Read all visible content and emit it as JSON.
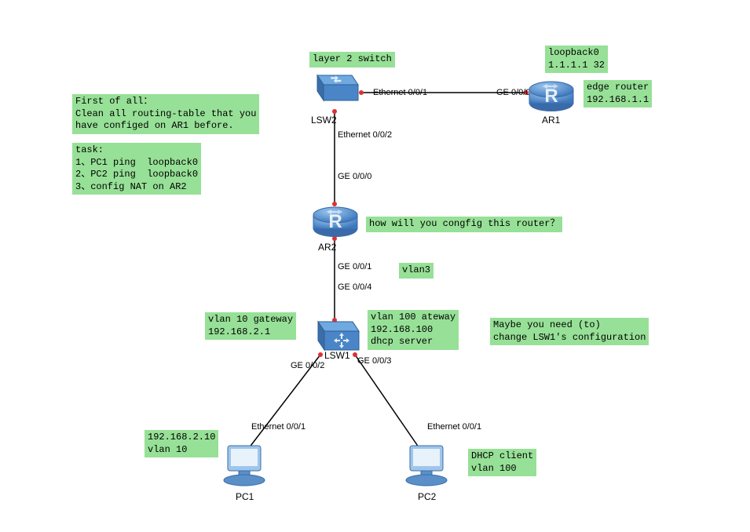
{
  "notes": {
    "layer2switch": "layer 2 switch",
    "loopback": "loopback0\n1.1.1.1 32",
    "edgeRouter": "edge router\n192.168.1.1",
    "firstOfAll": "First of all：\nClean all routing-table that you\nhave configed on AR1 before.",
    "task": "task:\n1、PC1 ping  loopback0\n2、PC2 ping  loopback0\n3、config NAT on AR2",
    "howConfig": "how will you congfig this router？",
    "vlan3": "vlan3",
    "vlan10gw": "vlan 10 gateway\n192.168.2.1",
    "vlan100gw": "vlan 100 ateway\n192.168.100\ndhcp server",
    "maybeNeed": "Maybe you need (to)\nchange LSW1's configuration",
    "pc1info": "192.168.2.10\nvlan 10",
    "pc2info": "DHCP client\nvlan 100"
  },
  "ports": {
    "lsw2_e001": "Ethernet 0/0/1",
    "ar1_ge000": "GE 0/0/0",
    "lsw2_e002": "Ethernet 0/0/2",
    "ar2_ge000": "GE 0/0/0",
    "ar2_ge001": "GE 0/0/1",
    "lsw1_ge004": "GE 0/0/4",
    "lsw1_ge002": "GE 0/0/2",
    "lsw1_ge003": "GE 0/0/3",
    "pc1_e001": "Ethernet 0/0/1",
    "pc2_e001": "Ethernet 0/0/1"
  },
  "devices": {
    "lsw2": "LSW2",
    "ar1": "AR1",
    "ar2": "AR2",
    "lsw1": "LSW1",
    "pc1": "PC1",
    "pc2": "PC2"
  }
}
